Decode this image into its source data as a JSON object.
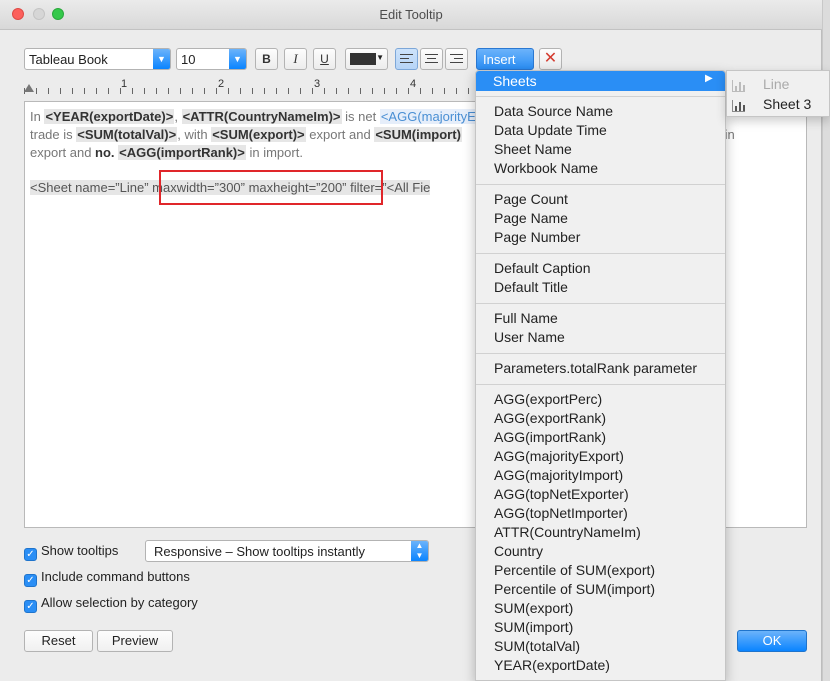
{
  "window": {
    "title": "Edit Tooltip"
  },
  "toolbar": {
    "font_family": "Tableau Book",
    "font_size": "10",
    "bold_label": "B",
    "italic_label": "I",
    "underline_label": "U",
    "insert_label": "Insert",
    "text_color": "#333333"
  },
  "ruler": {
    "ticks": [
      "1",
      "2",
      "3",
      "4"
    ]
  },
  "editor": {
    "line1": [
      {
        "t": "In ",
        "type": "text"
      },
      {
        "t": "<YEAR(exportDate)>",
        "type": "field"
      },
      {
        "t": ", ",
        "type": "text"
      },
      {
        "t": "<ATTR(CountryNameIm)>",
        "type": "field"
      },
      {
        "t": " is net ",
        "type": "text"
      },
      {
        "t": "<AGG(majorityE",
        "type": "field-blue"
      }
    ],
    "line2": [
      {
        "t": "trade is ",
        "type": "text"
      },
      {
        "t": "<SUM(totalVal)>",
        "type": "field"
      },
      {
        "t": ", with ",
        "type": "text"
      },
      {
        "t": "<SUM(export)>",
        "type": "field"
      },
      {
        "t": " export and ",
        "type": "text"
      },
      {
        "t": "<SUM(import)",
        "type": "field"
      }
    ],
    "line2_tail": [
      {
        "t": "nk)>",
        "type": "field"
      },
      {
        "t": " in",
        "type": "text"
      }
    ],
    "line3": [
      {
        "t": "export and ",
        "type": "text"
      },
      {
        "t": "no.",
        "type": "field-plain"
      },
      {
        "t": " ",
        "type": "text"
      },
      {
        "t": "<AGG(importRank)>",
        "type": "field"
      },
      {
        "t": " in import.",
        "type": "text"
      }
    ],
    "sheet_line": "<Sheet name=”Line” maxwidth=”300” maxheight=”200” filter=”<All Fie"
  },
  "options": {
    "show_tooltips_label": "Show tooltips",
    "tooltip_mode": "Responsive – Show tooltips instantly",
    "include_command_buttons_label": "Include command buttons",
    "allow_selection_label": "Allow selection by category"
  },
  "buttons": {
    "reset": "Reset",
    "preview": "Preview",
    "ok": "OK"
  },
  "insert_menu": {
    "selected": "Sheets",
    "groups": [
      [
        "Data Source Name",
        "Data Update Time",
        "Sheet Name",
        "Workbook Name"
      ],
      [
        "Page Count",
        "Page Name",
        "Page Number"
      ],
      [
        "Default Caption",
        "Default Title"
      ],
      [
        "Full Name",
        "User Name"
      ],
      [
        "Parameters.totalRank parameter"
      ],
      [
        "AGG(exportPerc)",
        "AGG(exportRank)",
        "AGG(importRank)",
        "AGG(majorityExport)",
        "AGG(majorityImport)",
        "AGG(topNetExporter)",
        "AGG(topNetImporter)",
        "ATTR(CountryNameIm)",
        "Country",
        "Percentile of SUM(export)",
        "Percentile of SUM(import)",
        "SUM(export)",
        "SUM(import)",
        "SUM(totalVal)",
        "YEAR(exportDate)"
      ]
    ]
  },
  "sheets_submenu": [
    {
      "label": "Line",
      "enabled": false
    },
    {
      "label": "Sheet 3",
      "enabled": true
    }
  ],
  "colors": {
    "accent": "#2a8ef5",
    "highlight_box": "#e0262a"
  }
}
